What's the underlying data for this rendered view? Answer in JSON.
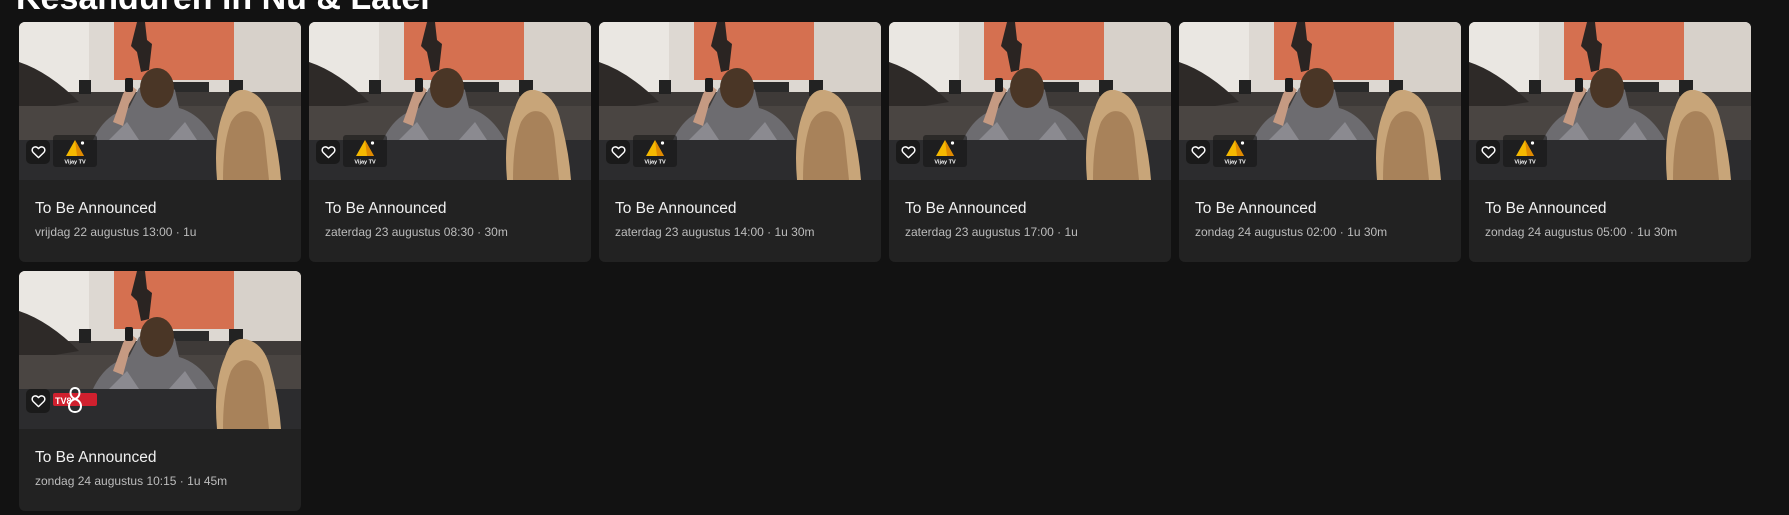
{
  "section": {
    "title": "Kesanduren in Nu & Later"
  },
  "cards": [
    {
      "title": "To Be Announced",
      "day": "vrijdag 22 augustus",
      "time": "13:00",
      "duration": "1u",
      "channel": "Vijay TV",
      "logo": "vijay-tv-logo-icon"
    },
    {
      "title": "To Be Announced",
      "day": "zaterdag 23 augustus",
      "time": "08:30",
      "duration": "30m",
      "channel": "Vijay TV",
      "logo": "vijay-tv-logo-icon"
    },
    {
      "title": "To Be Announced",
      "day": "zaterdag 23 augustus",
      "time": "14:00",
      "duration": "1u 30m",
      "channel": "Vijay TV",
      "logo": "vijay-tv-logo-icon"
    },
    {
      "title": "To Be Announced",
      "day": "zaterdag 23 augustus",
      "time": "17:00",
      "duration": "1u",
      "channel": "Vijay TV",
      "logo": "vijay-tv-logo-icon"
    },
    {
      "title": "To Be Announced",
      "day": "zondag 24 augustus",
      "time": "02:00",
      "duration": "1u 30m",
      "channel": "Vijay TV",
      "logo": "vijay-tv-logo-icon"
    },
    {
      "title": "To Be Announced",
      "day": "zondag 24 augustus",
      "time": "05:00",
      "duration": "1u 30m",
      "channel": "Vijay TV",
      "logo": "vijay-tv-logo-icon"
    },
    {
      "title": "To Be Announced",
      "day": "zondag 24 augustus",
      "time": "10:15",
      "duration": "1u 45m",
      "channel": "TV8",
      "logo": "tv8-logo-icon"
    }
  ],
  "icons": {
    "favorite": "heart-outline-icon"
  },
  "colors": {
    "background": "#121212",
    "card": "#222222",
    "vijay_yellow": "#f5b800",
    "tv8_red": "#d0202e"
  }
}
